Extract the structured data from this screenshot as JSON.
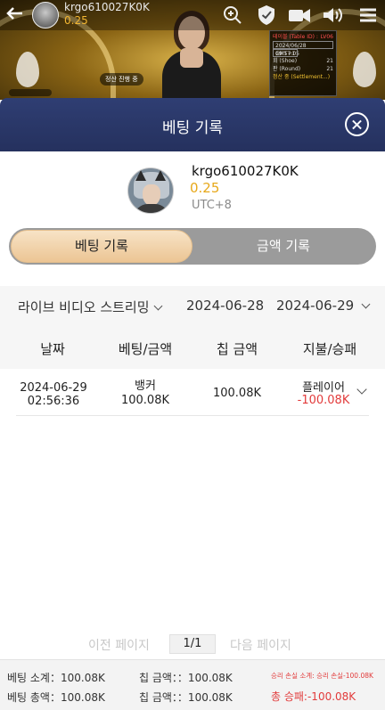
{
  "stream_header": {
    "username": "krgo610027K0K",
    "balance": "0.25",
    "video_tag": "정산 진행 중",
    "info_panel": {
      "table_label": "테이블 (Table ID) :",
      "table_id": "LV06",
      "date": "2024/06/28 19:57:05",
      "tz": "GMT+1",
      "shoe_label": "회 (Shoe)",
      "shoe_value": "21",
      "round_label": "판 (Round)",
      "round_value": "21",
      "settle": "정산 중 (Settlement...)"
    }
  },
  "modal": {
    "title": "베팅 기록"
  },
  "profile": {
    "username": "krgo610027K0K",
    "balance": "0.25",
    "timezone": "UTC+8"
  },
  "tabs": [
    {
      "label": "베팅 기록",
      "active": true
    },
    {
      "label": "금액 기록",
      "active": false
    }
  ],
  "filters": {
    "game": "라이브 비디오 스트리밍",
    "start_date": "2024-06-28",
    "end_date": "2024-06-29"
  },
  "table": {
    "headers": [
      "날짜",
      "베팅/금액",
      "칩 금액",
      "지불/승패"
    ],
    "rows": [
      {
        "date": "2024-06-29",
        "time": "02:56:36",
        "bet_on": "뱅커",
        "bet_amount": "100.08K",
        "chip_amount": "100.08K",
        "payout_on": "플레이어",
        "win_loss": "-100.08K"
      }
    ]
  },
  "pagination": {
    "prev": "이전 페이지",
    "current": "1/1",
    "next": "다음 페이지"
  },
  "summary": {
    "bet_subtotal": "베팅 소계：100.08K",
    "chip_subtotal": "칩 금액：：100.08K",
    "winloss_subtotal": "승리 손실 소계: 승리 손실-100.08K",
    "bet_total": "베팅 총액：100.08K",
    "chip_total": "칩 금액：：100.08K",
    "winloss_total": "총 승패:-100.08K"
  },
  "colors": {
    "modal_header": "#2f3e73",
    "balance": "#e7a81a",
    "loss": "#e23b3b",
    "active_tab": "#ecc594",
    "inactive_tab": "#9b9b9b"
  }
}
